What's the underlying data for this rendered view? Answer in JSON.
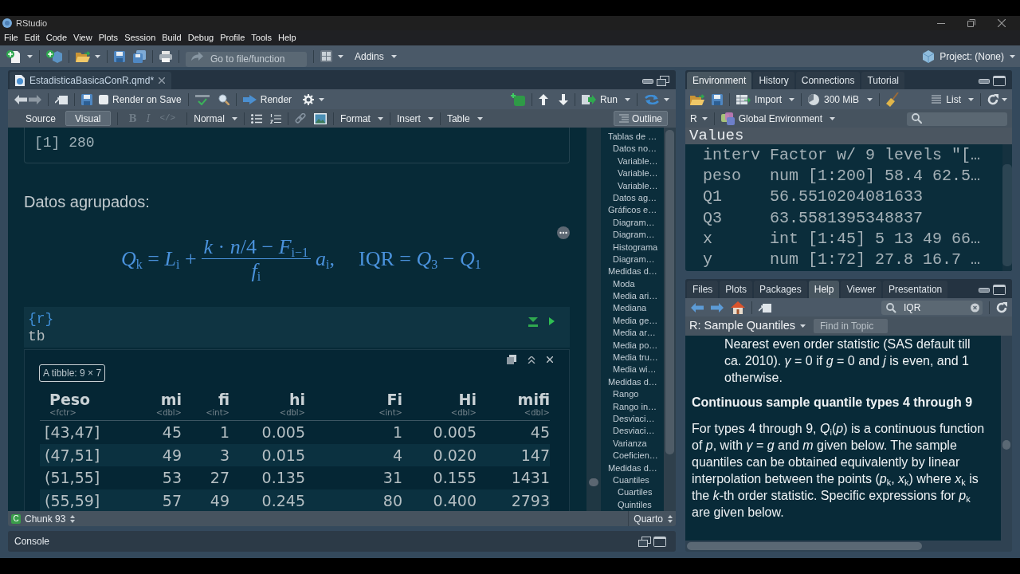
{
  "window": {
    "title": "RStudio"
  },
  "menu": [
    "File",
    "Edit",
    "Code",
    "View",
    "Plots",
    "Session",
    "Build",
    "Debug",
    "Profile",
    "Tools",
    "Help"
  ],
  "main_toolbar": {
    "goto": {
      "placeholder": "Go to file/function"
    },
    "addins": "Addins",
    "project": "Project: (None)"
  },
  "source_pane": {
    "tabs": [
      {
        "label": "EstadisticaBasicaConR.qmd*",
        "selected": true
      }
    ],
    "toolbar": {
      "render_on_save": {
        "label": "Render on Save",
        "checked": false
      },
      "render": "Render",
      "run": "Run"
    },
    "format_bar": {
      "modes": [
        {
          "label": "Source",
          "selected": false
        },
        {
          "label": "Visual",
          "selected": true
        }
      ],
      "marks": [
        {
          "kind": "bold",
          "label": "B",
          "disabled": true
        },
        {
          "kind": "italic",
          "label": "I",
          "disabled": true
        },
        {
          "kind": "code",
          "label": "</>",
          "disabled": true
        }
      ],
      "style": "Normal",
      "menus": [
        "Format",
        "Insert",
        "Table"
      ],
      "outline": {
        "label": "Outline",
        "on": true
      }
    },
    "document": {
      "output": "[1] 280",
      "paragraph": "Datos agrupados:",
      "equation": {
        "lhs": "*Q*$_{k}$ = *L*$_{i}$ +",
        "numerator": "*k* · *n*/4 − *F*$_{i−1}$",
        "denominator": "*f*$_{i}$",
        "factor": "*a*$_{i}$,",
        "rhs": "IQR = *Q*$_{3}$ − *Q*$_{1}$"
      },
      "chunk": {
        "header": "{r}",
        "code": "tb"
      },
      "tibble": {
        "caption": "A tibble: 9 × 7",
        "columns": [
          {
            "name": "Peso",
            "type": "<fctr>"
          },
          {
            "name": "mi",
            "type": "<dbl>"
          },
          {
            "name": "fi",
            "type": "<int>"
          },
          {
            "name": "hi",
            "type": "<dbl>"
          },
          {
            "name": "Fi",
            "type": "<int>"
          },
          {
            "name": "Hi",
            "type": "<dbl>"
          },
          {
            "name": "mifi",
            "type": "<dbl>"
          }
        ],
        "rows": [
          [
            "[43,47]",
            "45",
            "1",
            "0.005",
            "1",
            "0.005",
            "45"
          ],
          [
            "(47,51]",
            "49",
            "3",
            "0.015",
            "4",
            "0.020",
            "147"
          ],
          [
            "(51,55]",
            "53",
            "27",
            "0.135",
            "31",
            "0.155",
            "1431"
          ],
          [
            "(55,59]",
            "57",
            "49",
            "0.245",
            "80",
            "0.400",
            "2793"
          ]
        ]
      }
    },
    "outline": [
      {
        "label": "Tablas de …",
        "children": [
          {
            "label": "Datos no…",
            "children": [
              {
                "label": "Variable…"
              },
              {
                "label": "Variable…"
              },
              {
                "label": "Variable…"
              }
            ]
          },
          {
            "label": "Datos ag…"
          }
        ]
      },
      {
        "label": "Gráficos e…",
        "children": [
          {
            "label": "Diagram…"
          },
          {
            "label": "Diagram…"
          },
          {
            "label": "Histograma"
          },
          {
            "label": "Diagram…"
          }
        ]
      },
      {
        "label": "Medidas d…",
        "children": [
          {
            "label": "Moda"
          },
          {
            "label": "Media ari…"
          },
          {
            "label": "Mediana"
          },
          {
            "label": "Media ge…"
          },
          {
            "label": "Media ar…"
          },
          {
            "label": "Media po…"
          },
          {
            "label": "Media tru…"
          },
          {
            "label": "Media wi…"
          }
        ]
      },
      {
        "label": "Medidas d…",
        "children": [
          {
            "label": "Rango"
          },
          {
            "label": "Rango in…"
          },
          {
            "label": "Desviaci…"
          },
          {
            "label": "Desviaci…"
          },
          {
            "label": "Varianza"
          },
          {
            "label": "Coeficien…"
          }
        ]
      },
      {
        "label": "Medidas d…",
        "children": [
          {
            "label": "Cuantiles",
            "children": [
              {
                "label": "Cuartiles"
              },
              {
                "label": "Quintiles"
              }
            ]
          }
        ]
      }
    ],
    "status_bar": {
      "chunk_badge": "C",
      "chunk": "Chunk 93",
      "doc_type": "Quarto"
    }
  },
  "console": {
    "title": "Console"
  },
  "environment_pane": {
    "tabs": [
      {
        "label": "Environment",
        "selected": true
      },
      {
        "label": "History",
        "selected": false
      },
      {
        "label": "Connections",
        "selected": false
      },
      {
        "label": "Tutorial",
        "selected": false
      }
    ],
    "toolbar": {
      "import": "Import",
      "memory": "300 MiB",
      "view": "List"
    },
    "language": "R",
    "scope": "Global Environment",
    "section": "Values",
    "values": [
      {
        "name": "interv",
        "value": "Factor w/ 9 levels \"[…"
      },
      {
        "name": "peso",
        "value": "num [1:200] 58.4 62.5…"
      },
      {
        "name": "Q1",
        "value": "56.5510204081633"
      },
      {
        "name": "Q3",
        "value": "63.5581395348837"
      },
      {
        "name": "x",
        "value": "int [1:45] 5 13 49 66…"
      },
      {
        "name": "y",
        "value": "num [1:72] 27.8 16.7 …"
      }
    ]
  },
  "help_pane": {
    "tabs": [
      {
        "label": "Files",
        "selected": false
      },
      {
        "label": "Plots",
        "selected": false
      },
      {
        "label": "Packages",
        "selected": false
      },
      {
        "label": "Help",
        "selected": true
      },
      {
        "label": "Viewer",
        "selected": false
      },
      {
        "label": "Presentation",
        "selected": false
      }
    ],
    "search": {
      "value": "IQR"
    },
    "topic": "R: Sample Quantiles",
    "find": {
      "placeholder": "Find in Topic"
    },
    "content": [
      {
        "kind": "item",
        "text": "Nearest even order statistic (SAS default till ca. 2010). *γ* = 0 if *g* = 0 and *j* is even, and 1 otherwise."
      },
      {
        "kind": "heading",
        "text": "Continuous sample quantile types 4 through 9"
      },
      {
        "kind": "paragraph",
        "text": "For types 4 through 9, *Q*$_{i}$(*p*) is a continuous function of *p*, with *γ* = *g* and *m* given below. The sample quantiles can be obtained equivalently by linear interpolation between the points (*p*$_{k}$, *x*$_{k}$) where *x*$_{k}$ is the *k*-th order statistic. Specific expressions for *p*$_{k}$ are given below."
      }
    ]
  }
}
